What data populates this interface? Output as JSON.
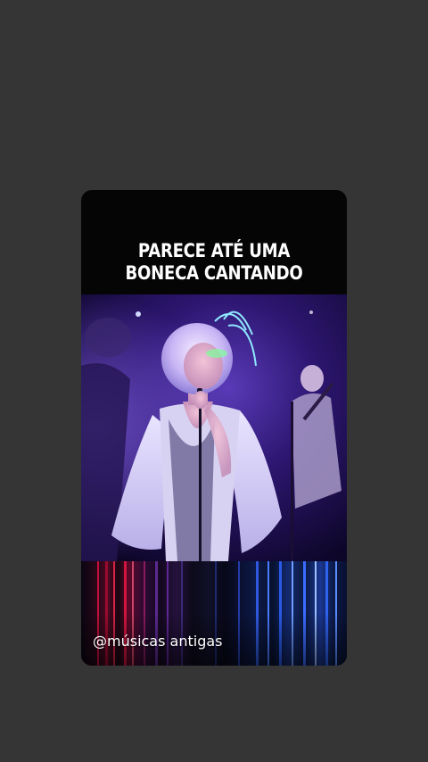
{
  "caption": {
    "line1": "PARECE ATÉ UMA",
    "line2": "BONECA CANTANDO"
  },
  "watermark": {
    "handle": "@músicas antigas"
  },
  "colors": {
    "screen_background": "#353535",
    "card_background": "#050505",
    "caption_text": "#ffffff"
  }
}
